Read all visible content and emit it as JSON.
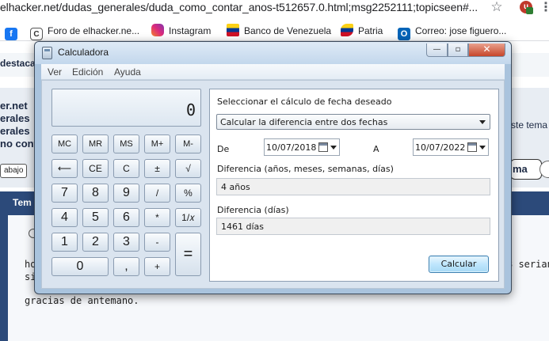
{
  "browser": {
    "url": "elhacker.net/dudas_generales/duda_como_contar_anos-t512657.0.html;msg2252111;topicseen#...",
    "extension_badge": "u",
    "bookmarks": [
      {
        "label": "Foro de elhacker.ne...",
        "icon": "C"
      },
      {
        "label": "Instagram"
      },
      {
        "label": "Banco de Venezuela"
      },
      {
        "label": "Patria"
      },
      {
        "label": "Correo: jose figuero..."
      }
    ],
    "facebook_icon": "f",
    "outlook_icon": "O"
  },
  "webpage": {
    "destaca": "destaca",
    "lines": [
      "er.net",
      "erales",
      "erales",
      "no cont"
    ],
    "abajo_button": "abajo",
    "right_text": "ste tema",
    "right_button": "ma",
    "tem_label": "Tem",
    "post_ho": "ho",
    "post_si": "si",
    "post_right": "3 serian",
    "post_gracias": "gracias de antemano."
  },
  "calculator": {
    "title": "Calculadora",
    "window_buttons": {
      "minimize": "—",
      "maximize": "▫",
      "close": "✕"
    },
    "menu": [
      "Ver",
      "Edición",
      "Ayuda"
    ],
    "display": "0",
    "keys": [
      {
        "label": "MC",
        "kind": "mem"
      },
      {
        "label": "MR",
        "kind": "mem"
      },
      {
        "label": "MS",
        "kind": "mem"
      },
      {
        "label": "M+",
        "kind": "mem"
      },
      {
        "label": "M-",
        "kind": "mem"
      },
      {
        "label": "⟵",
        "kind": "op"
      },
      {
        "label": "CE",
        "kind": "op"
      },
      {
        "label": "C",
        "kind": "op"
      },
      {
        "label": "±",
        "kind": "op"
      },
      {
        "label": "√",
        "kind": "op"
      },
      {
        "label": "7",
        "kind": "num"
      },
      {
        "label": "8",
        "kind": "num"
      },
      {
        "label": "9",
        "kind": "num"
      },
      {
        "label": "/",
        "kind": "op"
      },
      {
        "label": "%",
        "kind": "op"
      },
      {
        "label": "4",
        "kind": "num"
      },
      {
        "label": "5",
        "kind": "num"
      },
      {
        "label": "6",
        "kind": "num"
      },
      {
        "label": "*",
        "kind": "op"
      },
      {
        "label": "1/𝑥",
        "kind": "op"
      },
      {
        "label": "1",
        "kind": "num"
      },
      {
        "label": "2",
        "kind": "num"
      },
      {
        "label": "3",
        "kind": "num"
      },
      {
        "label": "-",
        "kind": "op"
      },
      {
        "label": "=",
        "kind": "eq"
      },
      {
        "label": "0",
        "kind": "zero"
      },
      {
        "label": ",",
        "kind": "num"
      },
      {
        "label": "+",
        "kind": "op"
      }
    ],
    "date_panel": {
      "select_label": "Seleccionar el cálculo de fecha deseado",
      "calc_type": "Calcular la diferencia entre dos fechas",
      "from_label": "De",
      "from_date": "10/07/2018",
      "to_label": "A",
      "to_date": "10/07/2022",
      "diff_label": "Diferencia (años, meses, semanas, días)",
      "diff_value": "4 años",
      "days_label": "Diferencia (días)",
      "days_value": "1461 días",
      "calculate_button": "Calcular"
    }
  }
}
